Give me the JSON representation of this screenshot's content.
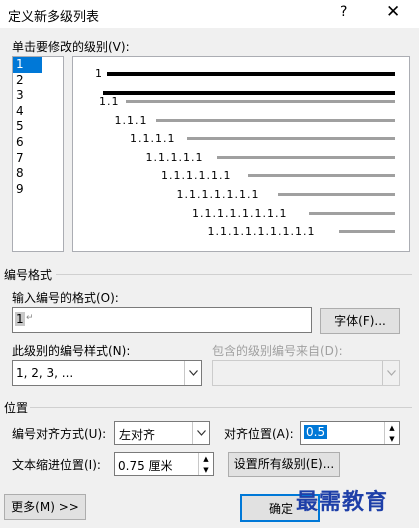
{
  "window": {
    "title": "定义新多级列表",
    "help": "?",
    "close": "✕"
  },
  "level_section": {
    "label": "单击要修改的级别(V):",
    "levels": [
      "1",
      "2",
      "3",
      "4",
      "5",
      "6",
      "7",
      "8",
      "9"
    ],
    "selected_index": 0
  },
  "preview": {
    "rows": [
      "1",
      "",
      "1.1",
      "1.1.1",
      "1.1.1.1",
      "1.1.1.1.1",
      "1.1.1.1.1.1",
      "1.1.1.1.1.1.1",
      "1.1.1.1.1.1.1.1",
      "1.1.1.1.1.1.1.1.1"
    ]
  },
  "number_format": {
    "section": "编号格式",
    "format_label": "输入编号的格式(O):",
    "format_value": "1",
    "font_button": "字体(F)...",
    "style_label": "此级别的编号样式(N):",
    "style_value": "1, 2, 3, ...",
    "include_label": "包含的级别编号来自(D):",
    "include_value": ""
  },
  "position": {
    "section": "位置",
    "align_label": "编号对齐方式(U):",
    "align_value": "左对齐",
    "align_at_label": "对齐位置(A):",
    "align_at_value": "0.5",
    "indent_label": "文本缩进位置(I):",
    "indent_value": "0.75 厘米",
    "set_all_button": "设置所有级别(E)..."
  },
  "footer": {
    "more_button": "更多(M) >>",
    "ok_button": "确定"
  },
  "watermark": "最需教育",
  "colors": {
    "selection": "#0078d7",
    "dialog_bg": "#f0f0f0"
  }
}
